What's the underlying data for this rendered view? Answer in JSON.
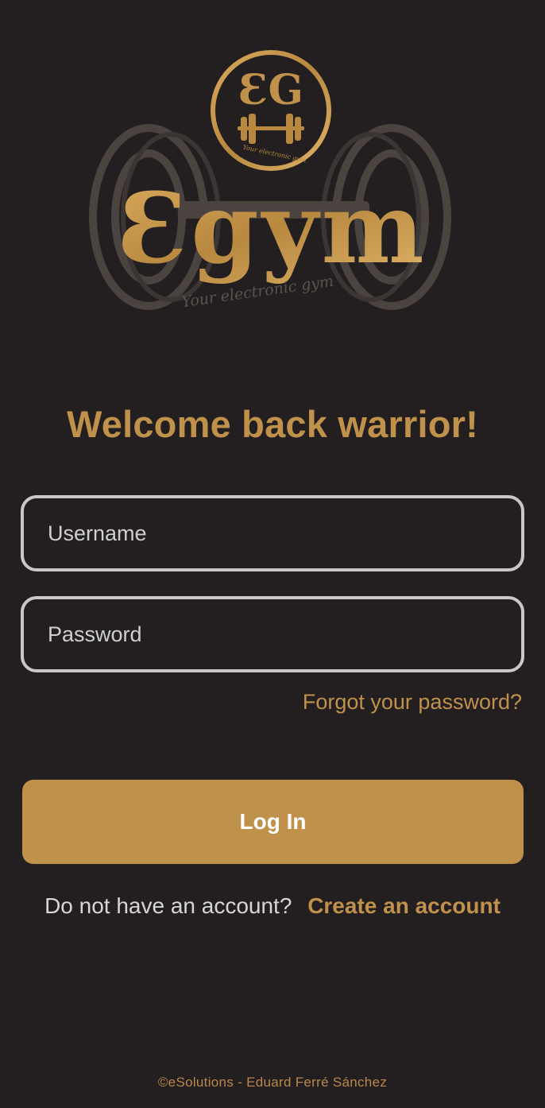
{
  "logo": {
    "emblem_monogram": "ƐG",
    "emblem_tagline": "Your electronic gym",
    "wordmark": "Ɛgym",
    "tagline": "Your electronic gym"
  },
  "colors": {
    "background": "#231f20",
    "accent": "#c0914b",
    "field_border": "#c9c7c8",
    "button_text": "#ffffff"
  },
  "welcome": {
    "title": "Welcome back warrior!"
  },
  "form": {
    "username_placeholder": "Username",
    "username_value": "",
    "password_placeholder": "Password",
    "password_value": "",
    "forgot_link": "Forgot your password?",
    "login_label": "Log In"
  },
  "signup": {
    "prompt": "Do not have an account?",
    "link": "Create an account"
  },
  "footer": {
    "text": "©eSolutions - Eduard Ferré Sánchez"
  }
}
